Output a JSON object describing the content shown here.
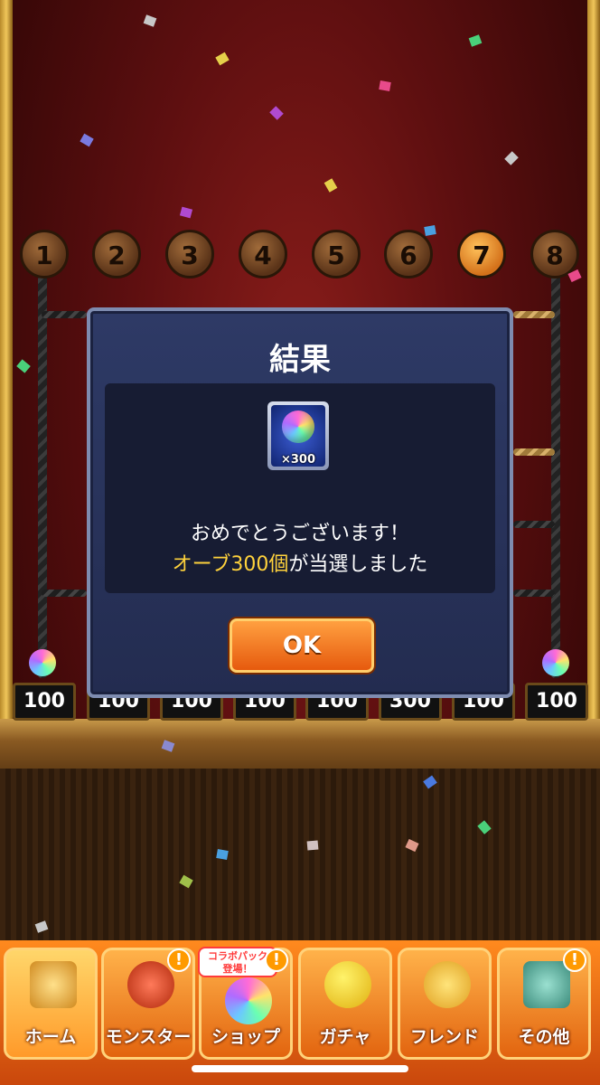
{
  "stage": {
    "ball_numbers": [
      "1",
      "2",
      "3",
      "4",
      "5",
      "6",
      "7",
      "8"
    ],
    "lit_ball": "7",
    "prizes": [
      "100",
      "100",
      "100",
      "100",
      "100",
      "300",
      "100",
      "100"
    ]
  },
  "modal": {
    "title": "結果",
    "reward_count": "×300",
    "message_line1": "おめでとうございます！",
    "message_highlight": "オーブ300個",
    "message_rest": "が当選しました",
    "ok_label": "OK"
  },
  "nav": {
    "items": [
      {
        "label": "ホーム",
        "icon": "home-icon"
      },
      {
        "label": "モンスター",
        "icon": "monster-icon",
        "alert": "!"
      },
      {
        "label": "ショップ",
        "icon": "shop-orb-icon",
        "alert": "!",
        "promo": "コラボパック\n登場！"
      },
      {
        "label": "ガチャ",
        "icon": "gacha-egg-icon"
      },
      {
        "label": "フレンド",
        "icon": "friends-icon"
      },
      {
        "label": "その他",
        "icon": "other-icon",
        "alert": "!"
      }
    ]
  },
  "colors": {
    "modal_bg": "#2a345e",
    "highlight": "#ffd23c",
    "ok_button": "#f57a20",
    "nav_bg": "#f07018"
  }
}
